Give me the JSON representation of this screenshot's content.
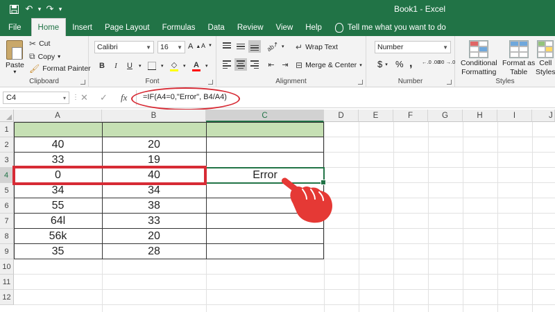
{
  "window": {
    "title": "Book1 - Excel"
  },
  "qat": {
    "save_icon": "save-icon",
    "undo_icon": "undo-icon",
    "redo_icon": "redo-icon"
  },
  "menu": {
    "tabs": [
      "File",
      "Home",
      "Insert",
      "Page Layout",
      "Formulas",
      "Data",
      "Review",
      "View",
      "Help"
    ],
    "active": "Home",
    "tell_me": "Tell me what you want to do"
  },
  "ribbon": {
    "clipboard": {
      "paste": "Paste",
      "cut": "Cut",
      "copy": "Copy",
      "format_painter": "Format Painter",
      "label": "Clipboard"
    },
    "font": {
      "name": "Calibri",
      "size": "16",
      "bold": "B",
      "italic": "I",
      "underline": "U",
      "label": "Font"
    },
    "alignment": {
      "wrap_text": "Wrap Text",
      "merge_center": "Merge & Center",
      "label": "Alignment"
    },
    "number": {
      "format": "Number",
      "currency": "$",
      "percent": "%",
      "comma": ",",
      "inc_dec": "←.0 .00",
      "dec_dec": ".00 →.0",
      "label": "Number"
    },
    "styles": {
      "conditional_1": "Conditional",
      "conditional_2": "Formatting",
      "format_table_1": "Format as",
      "format_table_2": "Table",
      "cell_styles_1": "Cell",
      "cell_styles_2": "Styles",
      "label": "Styles"
    }
  },
  "formula_bar": {
    "name_box": "C4",
    "fx": "fx",
    "formula": "=IF(A4=0,\"Error\", B4/A4)"
  },
  "sheet": {
    "columns": [
      "A",
      "B",
      "C",
      "D",
      "E",
      "F",
      "G",
      "H",
      "I",
      "J"
    ],
    "rows": [
      "1",
      "2",
      "3",
      "4",
      "5",
      "6",
      "7",
      "8",
      "9",
      "10",
      "11",
      "12"
    ],
    "selected_cell": "C4",
    "data": [
      {
        "a": "",
        "b": "",
        "c": ""
      },
      {
        "a": "40",
        "b": "20",
        "c": ""
      },
      {
        "a": "33",
        "b": "19",
        "c": ""
      },
      {
        "a": "0",
        "b": "40",
        "c": "Error"
      },
      {
        "a": "34",
        "b": "34",
        "c": ""
      },
      {
        "a": "55",
        "b": "38",
        "c": ""
      },
      {
        "a": "64l",
        "b": "33",
        "c": ""
      },
      {
        "a": "56k",
        "b": "20",
        "c": ""
      },
      {
        "a": "35",
        "b": "28",
        "c": ""
      }
    ]
  },
  "colors": {
    "excel_green": "#217346",
    "header_fill": "#c6e0b4",
    "highlight_red": "#d72b35"
  }
}
